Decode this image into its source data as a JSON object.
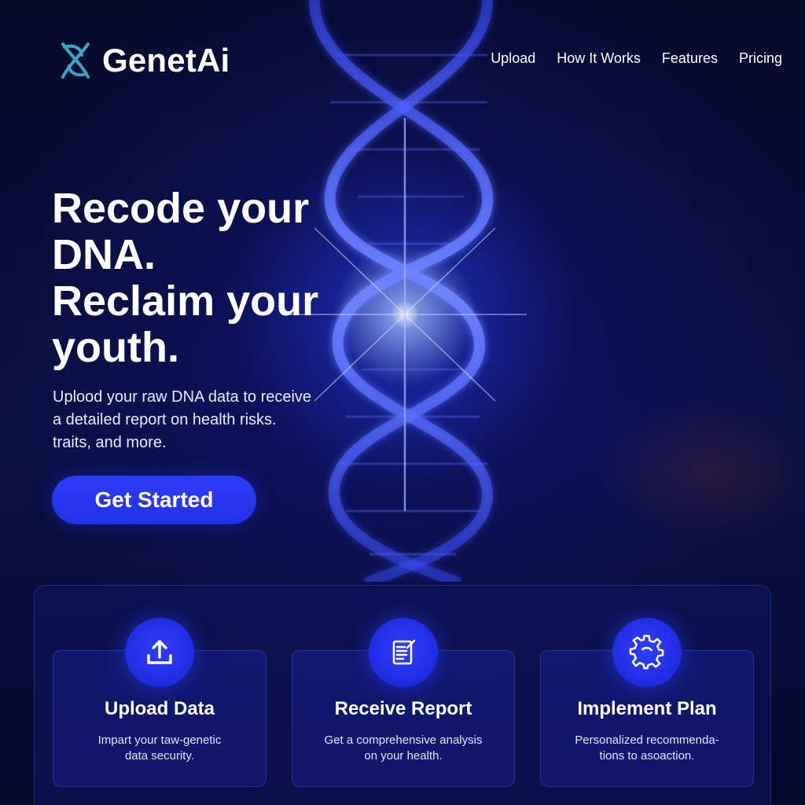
{
  "brand": {
    "name": "GenetAi",
    "icon": "dna-infinity-logo-icon",
    "logo_color": "#3aa6c4"
  },
  "nav": {
    "items": [
      {
        "label": "Upload"
      },
      {
        "label": "How It Works"
      },
      {
        "label": "Features"
      },
      {
        "label": "Pricing"
      }
    ]
  },
  "hero": {
    "title_lines": [
      "Recode your",
      "DNA.",
      "Reclaim your",
      "youth."
    ],
    "subtitle_lines": [
      "Uplood your raw DNA data to receive",
      "a detailed report on health risks.",
      "traits, and more."
    ],
    "cta_label": "Get Started"
  },
  "steps": [
    {
      "icon": "upload-icon",
      "title": "Upload Data",
      "desc_lines": [
        "Impart your taw-genetic",
        "data security."
      ]
    },
    {
      "icon": "document-report-icon",
      "title": "Receive Report",
      "desc_lines": [
        "Get a comprehensive analysis",
        "on your health."
      ]
    },
    {
      "icon": "gear-icon",
      "title": "Implement Plan",
      "desc_lines": [
        "Personalized recommenda-",
        "tions to asoaction."
      ]
    }
  ],
  "colors": {
    "background": "#070a2a",
    "accent": "#2d3df7",
    "panel": "#0e1660"
  }
}
